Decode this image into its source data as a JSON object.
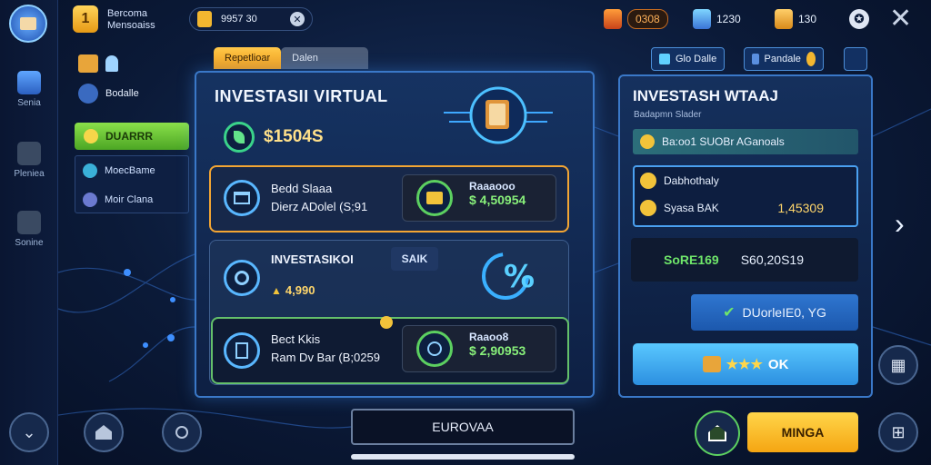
{
  "player": {
    "name_line1": "Bercoma",
    "name_line2": "Mensoaiss",
    "level_badge": "1"
  },
  "top_resources": {
    "pill_value": "9957 30",
    "gold": "0308"
  },
  "top_stats": [
    {
      "icon": "gift-icon",
      "value": "1230"
    },
    {
      "icon": "scroll-icon",
      "value": "130"
    }
  ],
  "left_rail": [
    {
      "label": "Senia"
    },
    {
      "label": "Pleniea"
    },
    {
      "label": "Sonine"
    }
  ],
  "side_menu": {
    "top_label": "Bodalle",
    "green_label": "DUARRR",
    "box_items": [
      "MoecBame",
      "Moir Clana"
    ]
  },
  "tabs": [
    {
      "label": "Repetlioar"
    },
    {
      "label": "Dalen"
    }
  ],
  "top_right_buttons": [
    {
      "label": "Glo Dalle"
    },
    {
      "label": "Pandale"
    }
  ],
  "main": {
    "title": "INVESTASII VIRTUAL",
    "balance": "$1504S",
    "card1": {
      "line1": "Bedd Slaaa",
      "line2": "Dierz ADolel (S;91",
      "tag": "Raaaooo",
      "value": "$ 4,50954"
    },
    "card2": {
      "title": "INVESTASIKOI",
      "tag": "SAIK",
      "value": "4,990"
    },
    "card3": {
      "line1": "Bect Kkis",
      "line2": "Ram Dv Bar (B;0259",
      "tag": "Raaoo8",
      "value": "$ 2,90953"
    }
  },
  "right": {
    "title": "INVESTASH WTAAJ",
    "subtitle": "Badapmn Slader",
    "teal_bar": "Ba:oo1 SUOBr AGanoals",
    "info_line1": "Dabhothaly",
    "info_line2_label": "Syasa BAK",
    "info_line2_value": "1,45309",
    "dark_label": "SoRE169",
    "dark_value": "S60,20S19",
    "blue_btn": "DUorleIE0, YG",
    "ok_btn": "OK"
  },
  "bottom": {
    "europa_label": "EUROVAA",
    "minga_label": "MINGA"
  },
  "colors": {
    "accent_orange": "#f3a533",
    "accent_green": "#64c06a",
    "panel_border": "#3a78c8",
    "value_green": "#88f07a"
  }
}
